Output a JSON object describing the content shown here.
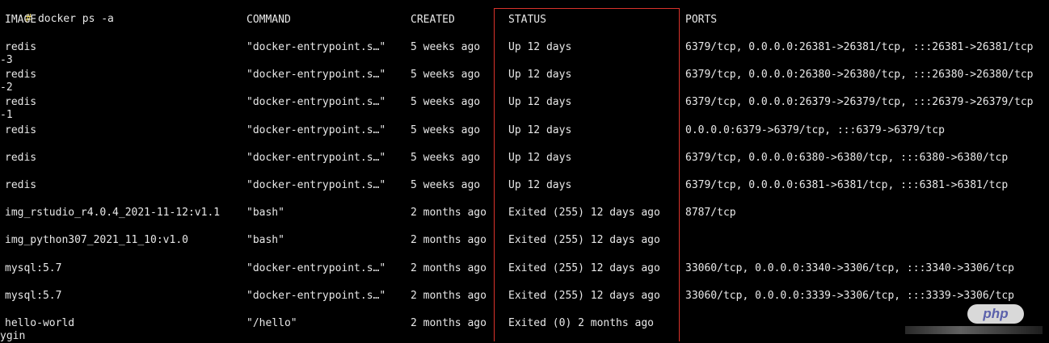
{
  "command_line": {
    "prompt": "#",
    "command": " docker ps -a"
  },
  "headers": [
    "IMAGE",
    "COMMAND",
    "CREATED",
    "STATUS",
    "PORTS"
  ],
  "rows": [
    {
      "image": "redis",
      "command": "\"docker-entrypoint.s…\"",
      "created": "5 weeks ago",
      "status": "Up 12 days",
      "ports": "6379/tcp, 0.0.0.0:26381->26381/tcp, :::26381->26381/tcp",
      "wrap": "-3"
    },
    {
      "image": "redis",
      "command": "\"docker-entrypoint.s…\"",
      "created": "5 weeks ago",
      "status": "Up 12 days",
      "ports": "6379/tcp, 0.0.0.0:26380->26380/tcp, :::26380->26380/tcp",
      "wrap": "-2"
    },
    {
      "image": "redis",
      "command": "\"docker-entrypoint.s…\"",
      "created": "5 weeks ago",
      "status": "Up 12 days",
      "ports": "6379/tcp, 0.0.0.0:26379->26379/tcp, :::26379->26379/tcp",
      "wrap": "-1"
    },
    {
      "image": "redis",
      "command": "\"docker-entrypoint.s…\"",
      "created": "5 weeks ago",
      "status": "Up 12 days",
      "ports": "0.0.0.0:6379->6379/tcp, :::6379->6379/tcp",
      "wrap": ""
    },
    {
      "image": "redis",
      "command": "\"docker-entrypoint.s…\"",
      "created": "5 weeks ago",
      "status": "Up 12 days",
      "ports": "6379/tcp, 0.0.0.0:6380->6380/tcp, :::6380->6380/tcp",
      "wrap": ""
    },
    {
      "image": "redis",
      "command": "\"docker-entrypoint.s…\"",
      "created": "5 weeks ago",
      "status": "Up 12 days",
      "ports": "6379/tcp, 0.0.0.0:6381->6381/tcp, :::6381->6381/tcp",
      "wrap": ""
    },
    {
      "image": "img_rstudio_r4.0.4_2021-11-12:v1.1",
      "command": "\"bash\"",
      "created": "2 months ago",
      "status": "Exited (255) 12 days ago",
      "ports": "8787/tcp",
      "wrap": ""
    },
    {
      "image": "img_python307_2021_11_10:v1.0",
      "command": "\"bash\"",
      "created": "2 months ago",
      "status": "Exited (255) 12 days ago",
      "ports": "",
      "wrap": ""
    },
    {
      "image": "mysql:5.7",
      "command": "\"docker-entrypoint.s…\"",
      "created": "2 months ago",
      "status": "Exited (255) 12 days ago",
      "ports": "33060/tcp, 0.0.0.0:3340->3306/tcp, :::3340->3306/tcp",
      "wrap": ""
    },
    {
      "image": "mysql:5.7",
      "command": "\"docker-entrypoint.s…\"",
      "created": "2 months ago",
      "status": "Exited (255) 12 days ago",
      "ports": "33060/tcp, 0.0.0.0:3339->3306/tcp, :::3339->3306/tcp",
      "wrap": ""
    },
    {
      "image": "hello-world",
      "command": "\"/hello\"",
      "created": "2 months ago",
      "status": "Exited (0) 2 months ago",
      "ports": "",
      "wrap": "ygin"
    }
  ],
  "watermark": "php",
  "colors": {
    "background": "#000000",
    "text": "#e8e8e8",
    "highlight_border": "#d9332b",
    "prompt": "#e8d25a"
  }
}
